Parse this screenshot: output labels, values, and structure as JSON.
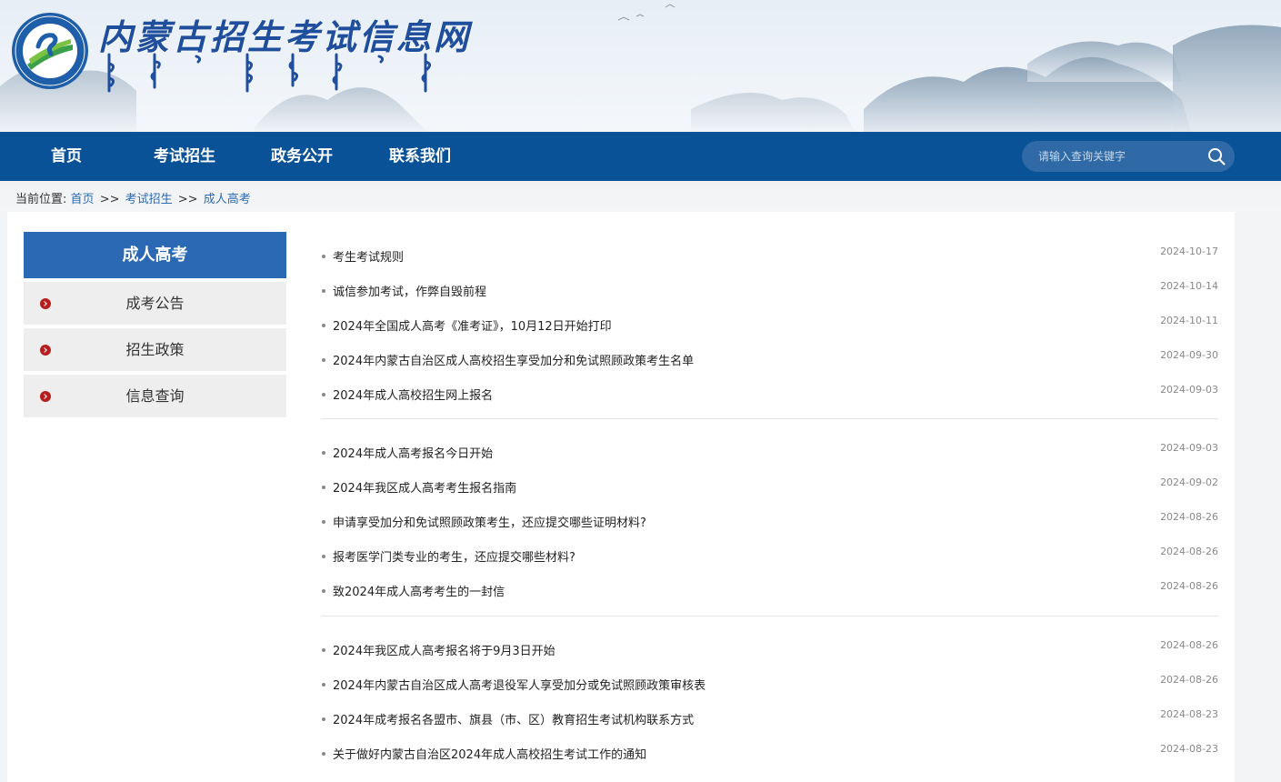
{
  "header": {
    "site_title": "内蒙古招生考试信息网",
    "logo_icon": "emblem-icon",
    "colors": {
      "title": "#1f4e9c",
      "nav_bg": "#0a5298",
      "accent": "#2b69b5",
      "bullet": "#b51f1f"
    }
  },
  "nav": {
    "items": [
      {
        "label": "首页"
      },
      {
        "label": "考试招生"
      },
      {
        "label": "政务公开"
      },
      {
        "label": "联系我们"
      }
    ],
    "search": {
      "placeholder": "请输入查询关键字"
    }
  },
  "breadcrumb": {
    "prefix": "当前位置:",
    "items": [
      "首页",
      "考试招生",
      "成人高考"
    ],
    "separator": ">>"
  },
  "sidebar": {
    "title": "成人高考",
    "items": [
      {
        "label": "成考公告"
      },
      {
        "label": "招生政策"
      },
      {
        "label": "信息查询"
      }
    ]
  },
  "news": {
    "groups": [
      [
        {
          "title": "考生考试规则",
          "date": "2024-10-17"
        },
        {
          "title": "诚信参加考试，作弊自毁前程",
          "date": "2024-10-14"
        },
        {
          "title": "2024年全国成人高考《准考证》，10月12日开始打印",
          "date": "2024-10-11"
        },
        {
          "title": "2024年内蒙古自治区成人高校招生享受加分和免试照顾政策考生名单",
          "date": "2024-09-30"
        },
        {
          "title": "2024年成人高校招生网上报名",
          "date": "2024-09-03"
        }
      ],
      [
        {
          "title": "2024年成人高考报名今日开始",
          "date": "2024-09-03"
        },
        {
          "title": "2024年我区成人高考考生报名指南",
          "date": "2024-09-02"
        },
        {
          "title": "申请享受加分和免试照顾政策考生，还应提交哪些证明材料?",
          "date": "2024-08-26"
        },
        {
          "title": "报考医学门类专业的考生，还应提交哪些材料?",
          "date": "2024-08-26"
        },
        {
          "title": "致2024年成人高考考生的一封信",
          "date": "2024-08-26"
        }
      ],
      [
        {
          "title": "2024年我区成人高考报名将于9月3日开始",
          "date": "2024-08-26"
        },
        {
          "title": "2024年内蒙古自治区成人高考退役军人享受加分或免试照顾政策审核表",
          "date": "2024-08-26"
        },
        {
          "title": "2024年成考报名各盟市、旗县（市、区）教育招生考试机构联系方式",
          "date": "2024-08-23"
        },
        {
          "title": "关于做好内蒙古自治区2024年成人高校招生考试工作的通知",
          "date": "2024-08-23"
        }
      ]
    ]
  }
}
